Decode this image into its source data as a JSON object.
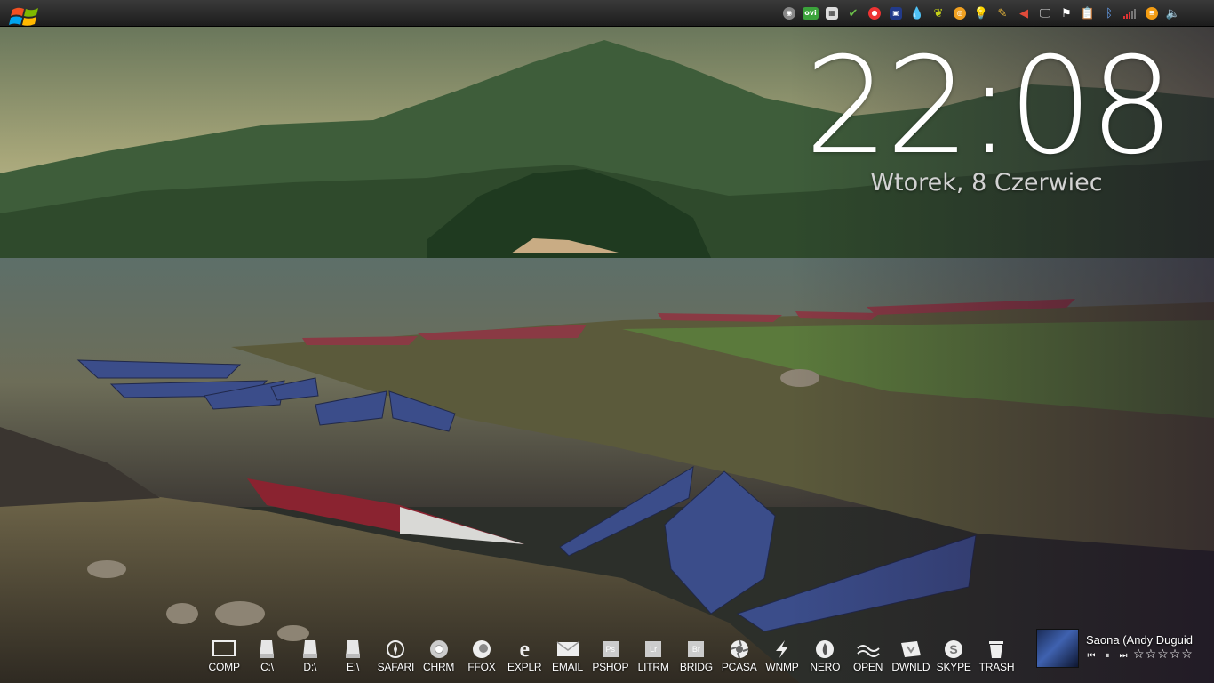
{
  "clock": {
    "time": "22:08",
    "date": "Wtorek, 8 Czerwiec"
  },
  "taskbar": {
    "tray": [
      {
        "icon": "cd-icon"
      },
      {
        "icon": "ovi-icon",
        "text": "ovi"
      },
      {
        "icon": "network-monitor-icon"
      },
      {
        "icon": "shield-check-icon"
      },
      {
        "icon": "stop-icon"
      },
      {
        "icon": "display-icon"
      },
      {
        "icon": "water-drop-icon"
      },
      {
        "icon": "leaf-icon"
      },
      {
        "icon": "orange-circle-icon"
      },
      {
        "icon": "lightbulb-icon"
      },
      {
        "icon": "pencil-icon"
      },
      {
        "icon": "alert-speaker-icon"
      },
      {
        "icon": "monitor-icon"
      },
      {
        "icon": "flag-icon"
      },
      {
        "icon": "clipboard-icon"
      },
      {
        "icon": "bluetooth-icon"
      },
      {
        "icon": "signal-icon"
      },
      {
        "icon": "menu-circle-icon"
      },
      {
        "icon": "volume-icon"
      }
    ]
  },
  "dock": [
    {
      "label": "COMP",
      "icon": "computer-icon"
    },
    {
      "label": "C:\\",
      "icon": "drive-icon"
    },
    {
      "label": "D:\\",
      "icon": "drive-icon"
    },
    {
      "label": "E:\\",
      "icon": "drive-icon"
    },
    {
      "label": "SAFARI",
      "icon": "compass-icon"
    },
    {
      "label": "CHRM",
      "icon": "chrome-icon"
    },
    {
      "label": "FFOX",
      "icon": "firefox-icon"
    },
    {
      "label": "EXPLR",
      "icon": "internet-explorer-icon"
    },
    {
      "label": "EMAIL",
      "icon": "envelope-icon"
    },
    {
      "label": "PSHOP",
      "icon": "photoshop-icon",
      "glyph": "Ps"
    },
    {
      "label": "LITRM",
      "icon": "lightroom-icon",
      "glyph": "Lr"
    },
    {
      "label": "BRIDG",
      "icon": "bridge-icon",
      "glyph": "Br"
    },
    {
      "label": "PCASA",
      "icon": "aperture-icon"
    },
    {
      "label": "WNMP",
      "icon": "lightning-icon"
    },
    {
      "label": "NERO",
      "icon": "flame-icon"
    },
    {
      "label": "OPEN",
      "icon": "wave-icon"
    },
    {
      "label": "DWNLD",
      "icon": "downloads-icon"
    },
    {
      "label": "SKYPE",
      "icon": "skype-icon"
    },
    {
      "label": "TRASH",
      "icon": "trash-icon"
    }
  ],
  "player": {
    "title": "Saona (Andy Duguid",
    "controls": [
      {
        "name": "previous-track-icon",
        "glyph": "⏮"
      },
      {
        "name": "pause-icon",
        "glyph": "⏸"
      },
      {
        "name": "next-track-icon",
        "glyph": "⏭"
      }
    ],
    "rating": 0,
    "stars": [
      "☆",
      "☆",
      "☆",
      "☆",
      "☆"
    ]
  },
  "colors": {
    "topbar": "#1c1c1c",
    "clock_text": "#ffffff",
    "date_text": "#d2d2d2",
    "label_text": "#ffffff"
  }
}
